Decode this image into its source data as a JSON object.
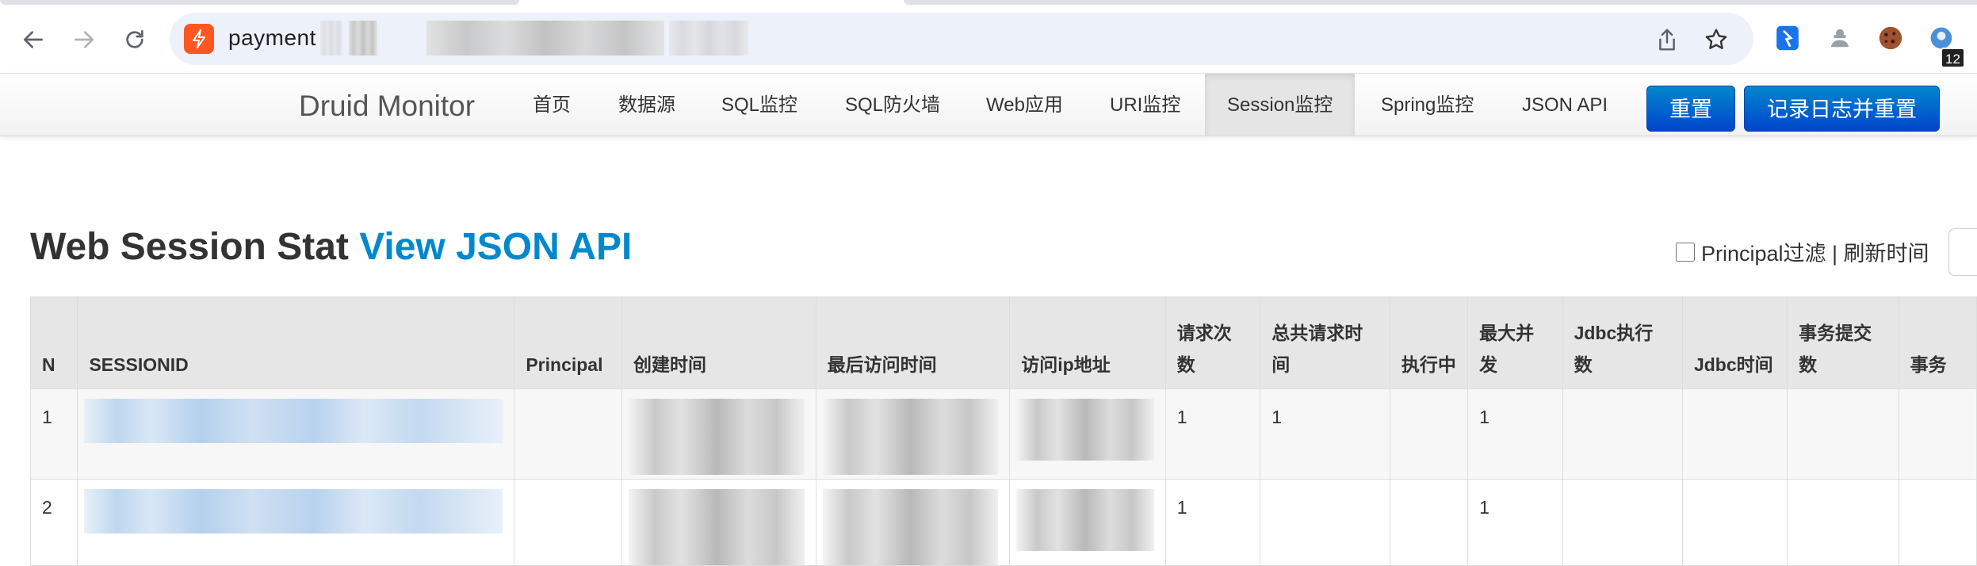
{
  "browser": {
    "address_text": "payment",
    "extension_badge": "12"
  },
  "navbar": {
    "brand": "Druid Monitor",
    "items": [
      {
        "label": "首页"
      },
      {
        "label": "数据源"
      },
      {
        "label": "SQL监控"
      },
      {
        "label": "SQL防火墙"
      },
      {
        "label": "Web应用"
      },
      {
        "label": "URI监控"
      },
      {
        "label": "Session监控",
        "active": true
      },
      {
        "label": "Spring监控"
      },
      {
        "label": "JSON API"
      }
    ],
    "reset_button": "重置",
    "log_reset_button": "记录日志并重置"
  },
  "page": {
    "title": "Web Session Stat",
    "json_link": "View JSON API",
    "principal_filter": "Principal过滤 | 刷新时间"
  },
  "table": {
    "headers": [
      "N",
      "SESSIONID",
      "Principal",
      "创建时间",
      "最后访问时间",
      "访问ip地址",
      "请求次数",
      "总共请求时间",
      "执行中",
      "最大并发",
      "Jdbc执行数",
      "Jdbc时间",
      "事务提交数",
      "事务"
    ],
    "rows": [
      {
        "n": "1",
        "requests": "1",
        "total_time": "1",
        "max_concurrency": "1"
      },
      {
        "n": "2",
        "requests": "1",
        "total_time": "",
        "max_concurrency": "1"
      }
    ]
  },
  "colors": {
    "accent": "#0088cc",
    "primary_button": "#0055cc",
    "site_icon": "#ff5722"
  },
  "icons": [
    "back-arrow-icon",
    "forward-arrow-icon",
    "reload-icon",
    "share-icon",
    "star-icon",
    "extension-icon",
    "incognito-icon",
    "cookie-icon",
    "profile-icon"
  ]
}
